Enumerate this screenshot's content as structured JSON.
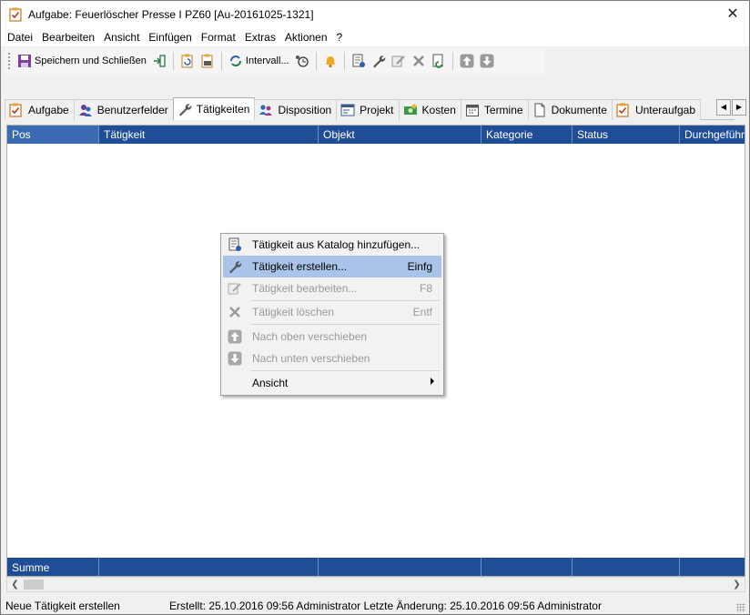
{
  "window": {
    "title": "Aufgabe: Feuerlöscher Presse I PZ60 [Au-20161025-1321]",
    "close_glyph": "✕"
  },
  "menu": [
    "Datei",
    "Bearbeiten",
    "Ansicht",
    "Einfügen",
    "Format",
    "Extras",
    "Aktionen",
    "?"
  ],
  "toolbar": {
    "save_close_label": "Speichern und Schließen",
    "interval_label": "Intervall..."
  },
  "tabs": [
    {
      "label": "Aufgabe",
      "icon": "task-check-icon"
    },
    {
      "label": "Benutzerfelder",
      "icon": "users-icon"
    },
    {
      "label": "Tätigkeiten",
      "icon": "wrench-icon",
      "active": true
    },
    {
      "label": "Disposition",
      "icon": "disposition-icon"
    },
    {
      "label": "Projekt",
      "icon": "project-icon"
    },
    {
      "label": "Kosten",
      "icon": "money-icon"
    },
    {
      "label": "Termine",
      "icon": "calendar-icon"
    },
    {
      "label": "Dokumente",
      "icon": "document-icon"
    },
    {
      "label": "Unteraufgab",
      "icon": "subtask-icon"
    }
  ],
  "grid": {
    "columns": [
      "Pos",
      "Tätigkeit",
      "Objekt",
      "Kategorie",
      "Status",
      "Durchgeführ"
    ],
    "footer_label": "Summe"
  },
  "context_menu": {
    "items": [
      {
        "label": "Tätigkeit aus Katalog hinzufügen...",
        "shortcut": "",
        "disabled": false
      },
      {
        "label": "Tätigkeit erstellen...",
        "shortcut": "Einfg",
        "disabled": false,
        "highlighted": true
      },
      {
        "label": "Tätigkeit bearbeiten...",
        "shortcut": "F8",
        "disabled": true
      },
      {
        "label": "Tätigkeit löschen",
        "shortcut": "Entf",
        "disabled": true
      },
      {
        "label": "Nach oben verschieben",
        "shortcut": "",
        "disabled": true
      },
      {
        "label": "Nach unten verschieben",
        "shortcut": "",
        "disabled": true
      },
      {
        "label": "Ansicht",
        "shortcut": "",
        "disabled": false,
        "submenu": true
      }
    ]
  },
  "statusbar": {
    "left": "Neue Tätigkeit erstellen",
    "right": "Erstellt: 25.10.2016 09:56 Administrator  Letzte Änderung: 25.10.2016 09:56 Administrator"
  },
  "colors": {
    "grid_header": "#1f4e96",
    "menu_highlight": "#a9c4e8",
    "accent_orange": "#e8a33a"
  }
}
